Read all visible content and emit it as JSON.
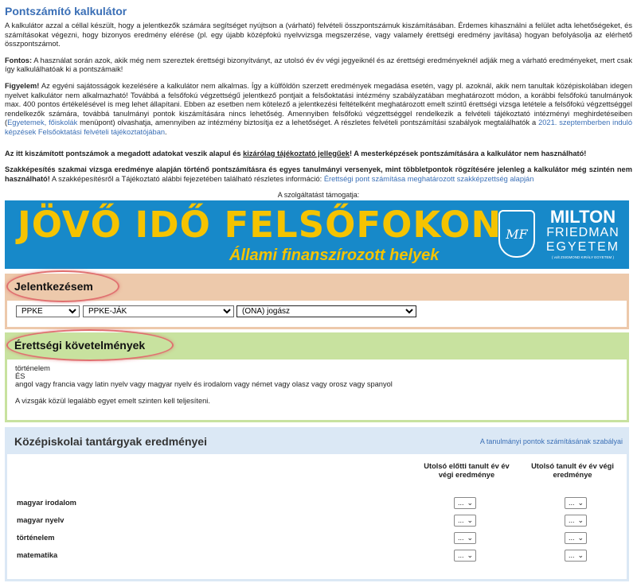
{
  "title": "Pontszámító kalkulátor",
  "intro": "A kalkulátor azzal a céllal készült, hogy a jelentkezők számára segítséget nyújtson a (várható) felvételi összpontszámuk kiszámításában. Érdemes kihasználni a felület adta lehetőségeket, és számításokat végezni, hogy bizonyos eredmény elérése (pl. egy újabb középfokú nyelvvizsga megszerzése, vagy valamely érettségi eredmény javítása) hogyan befolyásolja az elérhető összpontszámot.",
  "fontos_label": "Fontos:",
  "fontos_text": " A használat során azok, akik még nem szereztek érettségi bizonyítványt, az utolsó év év végi jegyeiknél és az érettségi eredményeknél adják meg a várható eredményeket, mert csak így kalkulálhatóak ki a pontszámaik!",
  "figyelem_label": "Figyelem!",
  "figyelem_text": " Az egyéni sajátosságok kezelésére a kalkulátor nem alkalmas. Így a külföldön szerzett eredmények megadása esetén, vagy pl. azoknál, akik nem tanultak középiskolában idegen nyelvet kalkulátor nem alkalmazható! Továbbá a felsőfokú végzettségű jelentkező pontjait a felsőoktatási intézmény szabályzatában meghatározott módon, a korábbi felsőfokú tanulmányok max. 400 pontos értékelésével is meg lehet állapítani. Ebben az esetben nem kötelező a jelentkezési feltételként meghatározott emelt szintű érettségi vizsga letétele a felsőfokú végzettséggel rendelkezők számára, továbbá tanulmányi pontok kiszámítására nincs lehetőség. Amennyiben felsőfokú végzettséggel rendelkezik a felvételi tájékoztató intézményi meghirdetéseiben (",
  "figyelem_link1": "Egyetemek, főiskolák",
  "figyelem_text2": " menüpont) olvashatja, amennyiben az intézmény biztosítja ez a lehetőséget. A részletes felvételi pontszámítási szabályok megtalálhatók a ",
  "figyelem_link2": "2021. szeptemberben induló képzések Felsőoktatási felvételi tájékoztatójában",
  "figyelem_end": ".",
  "notice1_a": "Az itt kiszámított pontszámok a megadott adatokat veszik alapul és ",
  "notice1_u": "kizárólag tájékoztató jellegűek",
  "notice1_b": "! A mesterképzések pontszámítására a kalkulátor nem használható!",
  "notice2_bold": "Szakképesítés szakmai vizsga eredménye alapján történő pontszámításra és egyes tanulmányi versenyek, mint többletpontok rögzítésére jelenleg a kalkulátor még szintén nem használható!",
  "notice2_text": " A szakképesítésről a Tájékoztató alábbi fejezetében található részletes információ: ",
  "notice2_link": "Érettségi pont számítása meghatározott szakképzettség alapján",
  "sponsor_label": "A szolgáltatást támogatja:",
  "banner": {
    "headline": "JÖVŐ IDŐ FELSŐFOKON",
    "subline": "Állami finanszírozott helyek",
    "logo": "MF",
    "uni_l1": "MILTON",
    "uni_l2": "FRIEDMAN",
    "uni_l3": "EGYETEM",
    "uni_l4": "( volt ZSIGMOND KIRÁLY EGYETEM )"
  },
  "jelentkezesem": {
    "title": "Jelentkezésem",
    "institution": "PPKE",
    "faculty": "PPKE-JÁK",
    "program": "(ONA) jogász"
  },
  "erettsegi": {
    "title": "Érettségi követelmények",
    "line1": "történelem",
    "line2": "ÉS",
    "line3": "angol vagy francia vagy latin nyelv vagy magyar nyelv és irodalom vagy német vagy olasz vagy orosz vagy spanyol",
    "line4": "A vizsgák közül legalább egyet emelt szinten kell teljesíteni."
  },
  "kozepiskolai": {
    "title": "Középiskolai tantárgyak eredményei",
    "rule_link": "A tanulmányi pontok számításának szabályai",
    "col1": "Utolsó előtti tanult év év végi eredménye",
    "col2": "Utolsó tanult év év végi eredménye",
    "select_value": "...",
    "subjects": [
      "magyar irodalom",
      "magyar nyelv",
      "történelem",
      "matematika"
    ]
  }
}
